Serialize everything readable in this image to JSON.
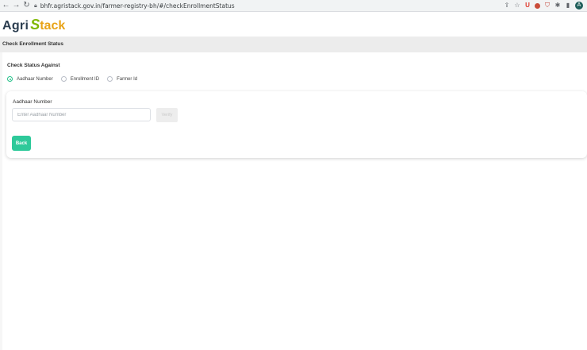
{
  "browser": {
    "url": "bhfr.agristack.gov.in/farmer-registry-bh/#/checkEnrollmentStatus",
    "back_icon": "arrow-left-icon",
    "forward_icon": "arrow-right-icon",
    "reload_icon": "reload-icon",
    "avatar_letter": "A"
  },
  "logo": {
    "part1": "Agri",
    "part2": "S",
    "part3": "tack",
    "colors": {
      "agri": "#2c3e50",
      "s": "#7fb800",
      "tack": "#e8a317"
    }
  },
  "page": {
    "title": "Check Enrollment Status",
    "check_status_label": "Check Status Against"
  },
  "radios": [
    {
      "label": "Aadhaar Number",
      "checked": true
    },
    {
      "label": "Enrollment ID",
      "checked": false
    },
    {
      "label": "Farmer Id",
      "checked": false
    }
  ],
  "form": {
    "aadhaar_label": "Aadhaar Number",
    "aadhaar_placeholder": "Enter Aadhaar Number",
    "aadhaar_value": "",
    "verify_label": "Verify",
    "back_label": "Back"
  },
  "colors": {
    "accent": "#2ec99a",
    "radio_checked": "#27c18a",
    "titlebar_bg": "#ececec"
  }
}
